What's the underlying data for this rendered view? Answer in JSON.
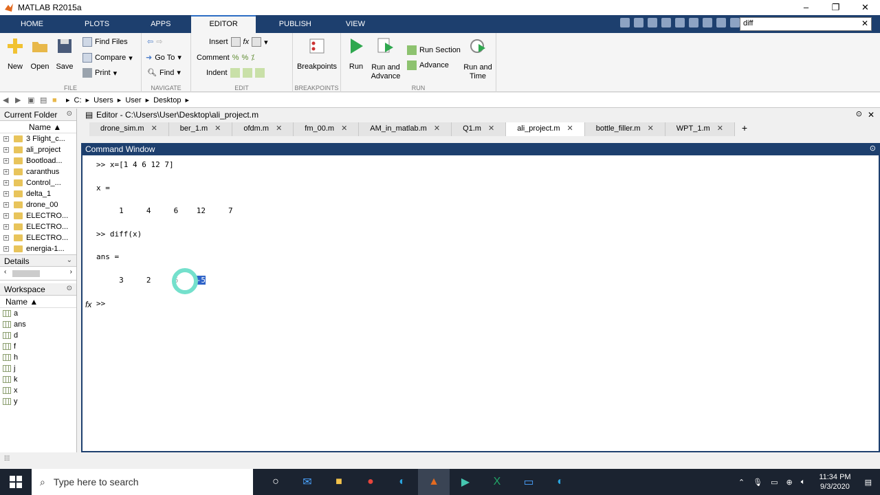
{
  "window": {
    "title": "MATLAB R2015a",
    "controls": [
      "–",
      "❐",
      "✕"
    ]
  },
  "ribbon_tabs": [
    "HOME",
    "PLOTS",
    "APPS",
    "EDITOR",
    "PUBLISH",
    "VIEW"
  ],
  "search": {
    "value": "diff"
  },
  "ribbon": {
    "file": {
      "new": "New",
      "open": "Open",
      "save": "Save",
      "find_files": "Find Files",
      "compare": "Compare",
      "print": "Print",
      "label": "FILE"
    },
    "navigate": {
      "goto": "Go To",
      "find": "Find",
      "label": "NAVIGATE"
    },
    "edit": {
      "insert": "Insert",
      "comment": "Comment",
      "indent": "Indent",
      "label": "EDIT"
    },
    "breakpoints": {
      "btn": "Breakpoints",
      "label": "BREAKPOINTS"
    },
    "run": {
      "run": "Run",
      "run_advance": "Run and",
      "run_advance2": "Advance",
      "run_section": "Run Section",
      "advance": "Advance",
      "run_time": "Run and",
      "run_time2": "Time",
      "label": "RUN"
    }
  },
  "address": {
    "parts": [
      "C:",
      "Users",
      "User",
      "Desktop"
    ]
  },
  "current_folder": {
    "title": "Current Folder",
    "column": "Name ▲",
    "items": [
      "3 Flight_c...",
      "ali_project",
      "Bootload...",
      "caranthus",
      "Control_...",
      "delta_1",
      "drone_00",
      "ELECTRO...",
      "ELECTRO...",
      "ELECTRO...",
      "energia-1..."
    ]
  },
  "details": {
    "title": "Details"
  },
  "workspace": {
    "title": "Workspace",
    "column": "Name ▲",
    "vars": [
      "a",
      "ans",
      "d",
      "f",
      "h",
      "j",
      "k",
      "x",
      "y"
    ]
  },
  "editor": {
    "title": "Editor - C:\\Users\\User\\Desktop\\ali_project.m",
    "tabs": [
      "drone_sim.m",
      "ber_1.m",
      "ofdm.m",
      "fm_00.m",
      "AM_in_matlab.m",
      "Q1.m",
      "ali_project.m",
      "bottle_filler.m",
      "WPT_1.m"
    ],
    "add": "+"
  },
  "command_window": {
    "title": "Command Window",
    "lines": [
      ">> x=[1 4 6 12 7]",
      "",
      "x =",
      "",
      "     1     4     6    12     7",
      "",
      ">> diff(x)",
      "",
      "ans =",
      ""
    ],
    "ans_prefix": "     3     2     6    ",
    "ans_selected": "-5",
    "prompt": ">>",
    "fx": "fx"
  },
  "taskbar": {
    "search_placeholder": "Type here to search",
    "time": "11:34 PM",
    "date": "9/3/2020"
  }
}
